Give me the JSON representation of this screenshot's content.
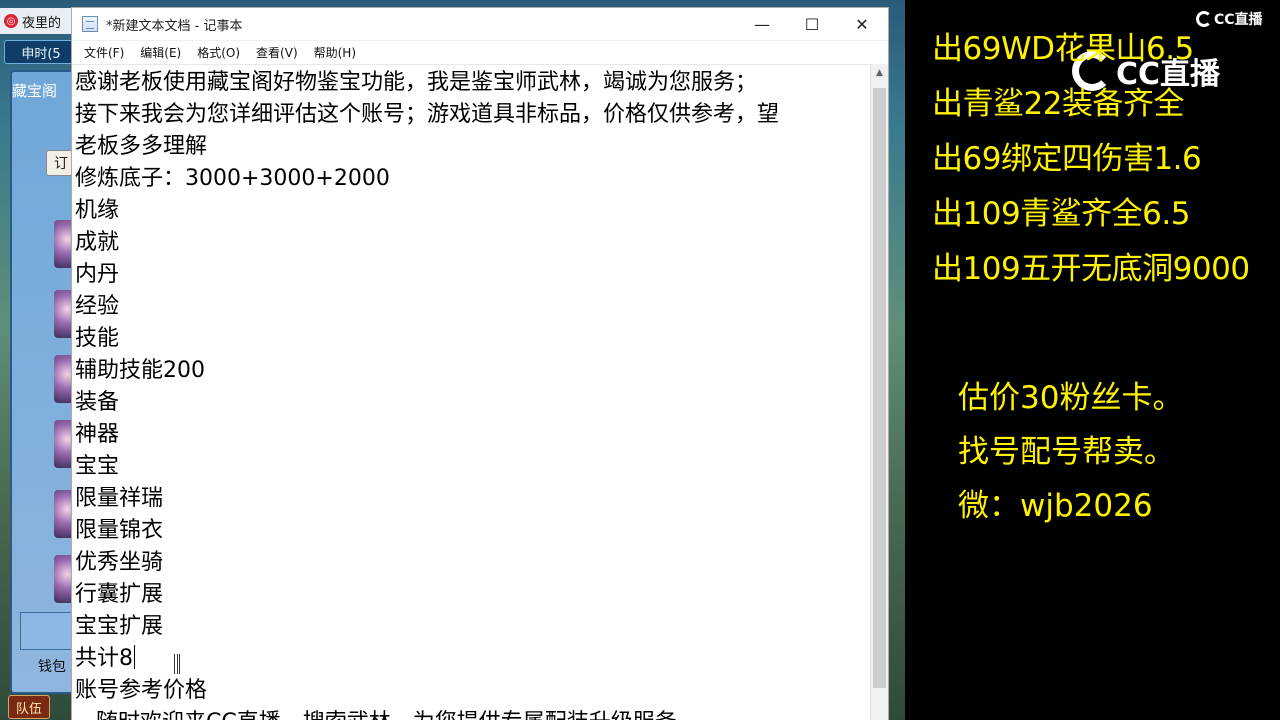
{
  "game": {
    "title": "夜里的",
    "time_label": "申时(5",
    "panel_title": "藏宝阁",
    "panel_button": "订",
    "wallet_label": "钱包",
    "team_button": "队伍"
  },
  "notepad": {
    "title": "*新建文本文档 - 记事本",
    "controls": {
      "minimize": "—",
      "maximize": "☐",
      "close": "✕"
    },
    "menu": [
      "文件(F)",
      "编辑(E)",
      "格式(O)",
      "查看(V)",
      "帮助(H)"
    ],
    "lines": [
      "感谢老板使用藏宝阁好物鉴宝功能，我是鉴宝师武林，竭诚为您服务；",
      "接下来我会为您详细评估这个账号；游戏道具非标品，价格仅供参考，望",
      "老板多多理解",
      "修炼底子：3000+3000+2000",
      "机缘",
      "成就",
      "内丹",
      "经验",
      "技能",
      "辅助技能200",
      "装备",
      "神器",
      "宝宝",
      "限量祥瑞",
      "限量锦衣",
      "优秀坐骑",
      "行囊扩展",
      "宝宝扩展",
      "共计8",
      "账号参考价格",
      "   随时欢迎来CC直播，搜索武林，为您提供专属配装升级服务"
    ]
  },
  "overlay": {
    "lines": [
      "出69WD花果山6.5",
      "出青鲨22装备齐全",
      "出69绑定四伤害1.6",
      "出109青鲨齐全6.5",
      "出109五开无底洞9000"
    ],
    "notes": [
      "估价30粉丝卡。",
      "找号配号帮卖。",
      "微：wjb2026"
    ],
    "watermark_small": "CC直播",
    "watermark_big": "CC直播",
    "text_color": "#fff200"
  }
}
